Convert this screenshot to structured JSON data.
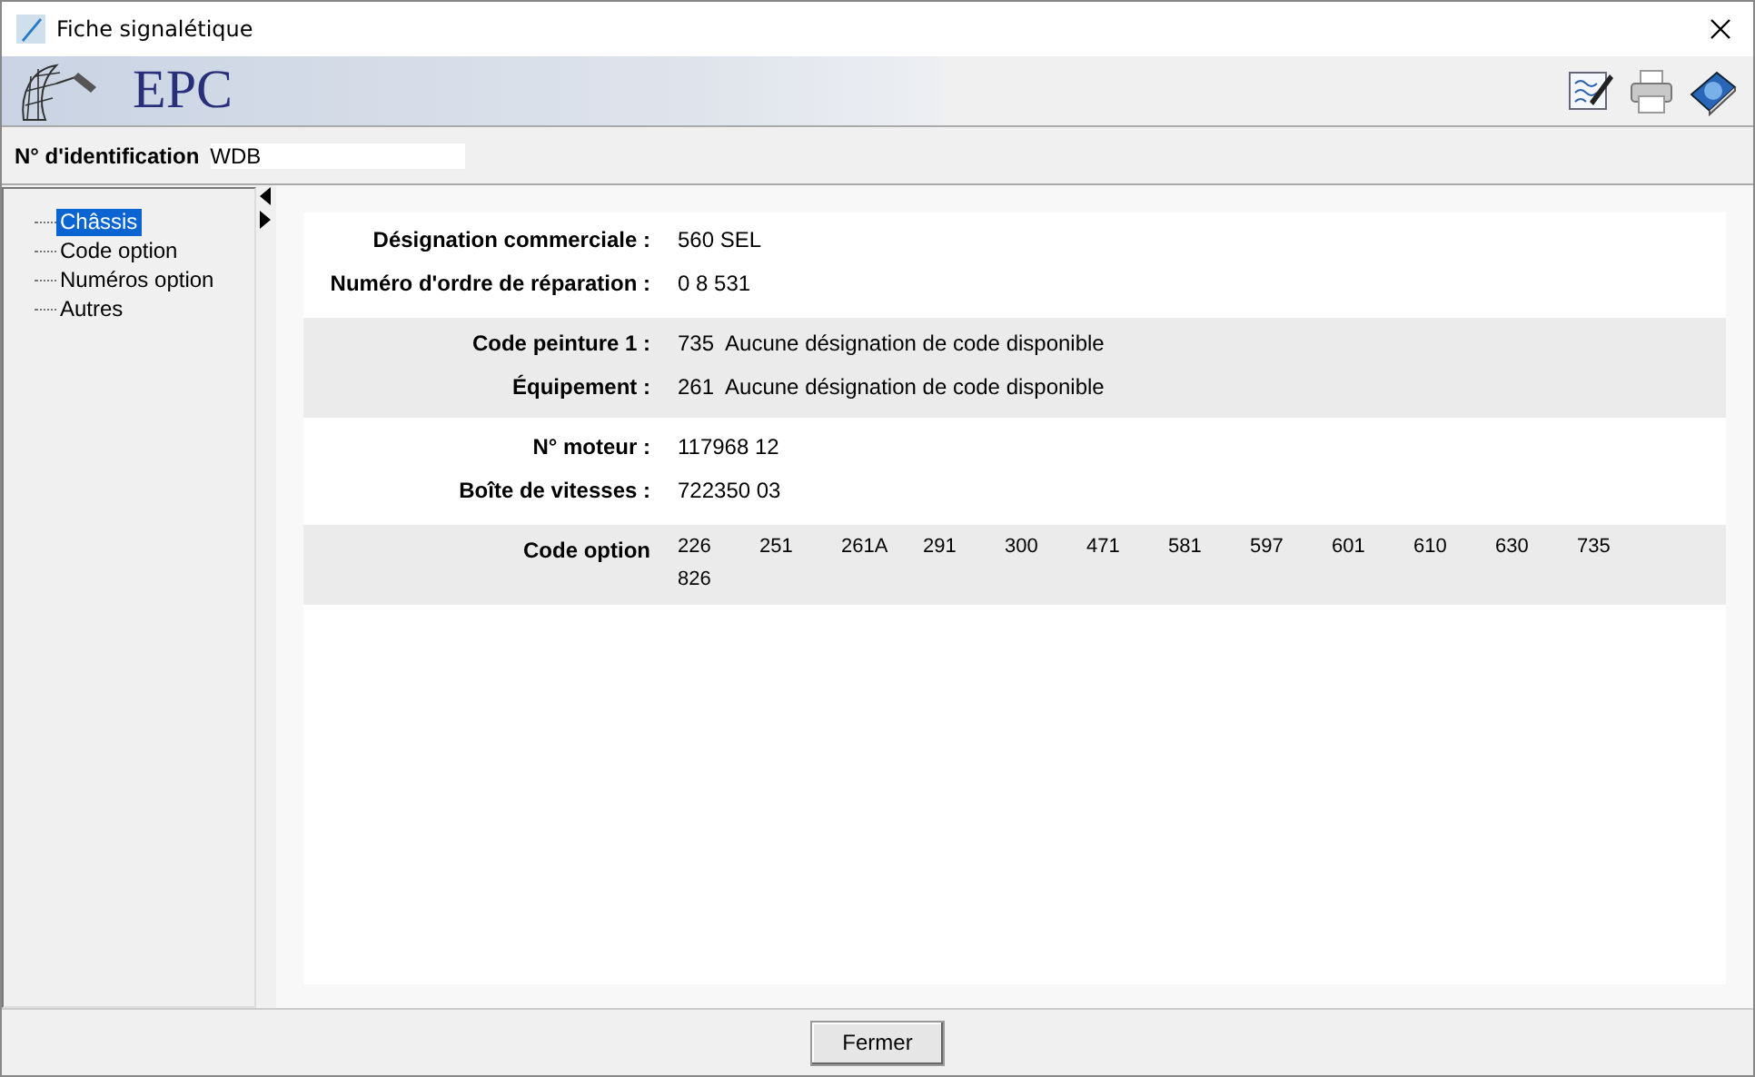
{
  "window": {
    "title": "Fiche signalétique"
  },
  "header": {
    "logo": "EPC"
  },
  "identification": {
    "label": "N° d'identification",
    "value": "WDB"
  },
  "sidebar": {
    "items": [
      {
        "label": "Châssis",
        "selected": true
      },
      {
        "label": "Code option",
        "selected": false
      },
      {
        "label": "Numéros option",
        "selected": false
      },
      {
        "label": "Autres",
        "selected": false
      }
    ]
  },
  "sections": [
    {
      "fields": [
        {
          "kind": "text",
          "label": "Désignation commerciale :",
          "value": "560 SEL"
        },
        {
          "kind": "text",
          "label": "Numéro d'ordre de réparation :",
          "value": "0 8 531"
        }
      ]
    },
    {
      "fields": [
        {
          "kind": "coded",
          "label": "Code peinture 1 :",
          "code": "735",
          "description": "Aucune désignation de code disponible"
        },
        {
          "kind": "coded",
          "label": "Équipement :",
          "code": "261",
          "description": "Aucune désignation de code disponible"
        }
      ]
    },
    {
      "fields": [
        {
          "kind": "text",
          "label": "N° moteur :",
          "value": "117968 12"
        },
        {
          "kind": "text",
          "label": "Boîte de vitesses :",
          "value": "722350 03"
        }
      ]
    },
    {
      "fields": [
        {
          "kind": "codes",
          "label": "Code option",
          "codes": [
            "226",
            "251",
            "261A",
            "291",
            "300",
            "471",
            "581",
            "597",
            "601",
            "610",
            "630",
            "735",
            "826"
          ]
        }
      ]
    }
  ],
  "buttons": [
    "Fermer"
  ]
}
